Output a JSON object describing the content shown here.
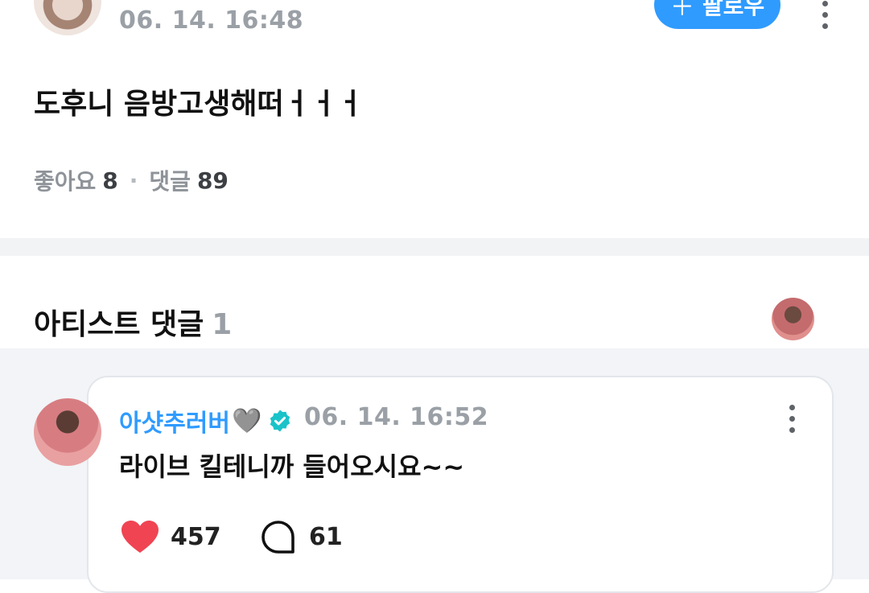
{
  "post": {
    "timestamp": "06. 14. 16:48",
    "follow_label": "팔로우",
    "follow_icon": "plus-icon",
    "body": "도후니 음방고생해떠ㅓㅓㅓ",
    "likes_label": "좋아요",
    "likes_count": "8",
    "comments_label": "댓글",
    "comments_count": "89"
  },
  "artist_section": {
    "title": "아티스트 댓글",
    "count": "1"
  },
  "comment": {
    "author": "아샷추러버",
    "author_badge": "🩶",
    "timestamp": "06. 14. 16:52",
    "text": "라이브 킬테니까 들어오시요~~",
    "likes": "457",
    "replies": "61",
    "like_icon": "heart-icon",
    "reply_icon": "speech-bubble-icon",
    "verified_icon": "verified-badge-icon"
  },
  "colors": {
    "accent": "#2f9bff",
    "heart": "#f04452",
    "muted_text": "#9aa0a6",
    "section_bg": "#f2f4f7"
  }
}
